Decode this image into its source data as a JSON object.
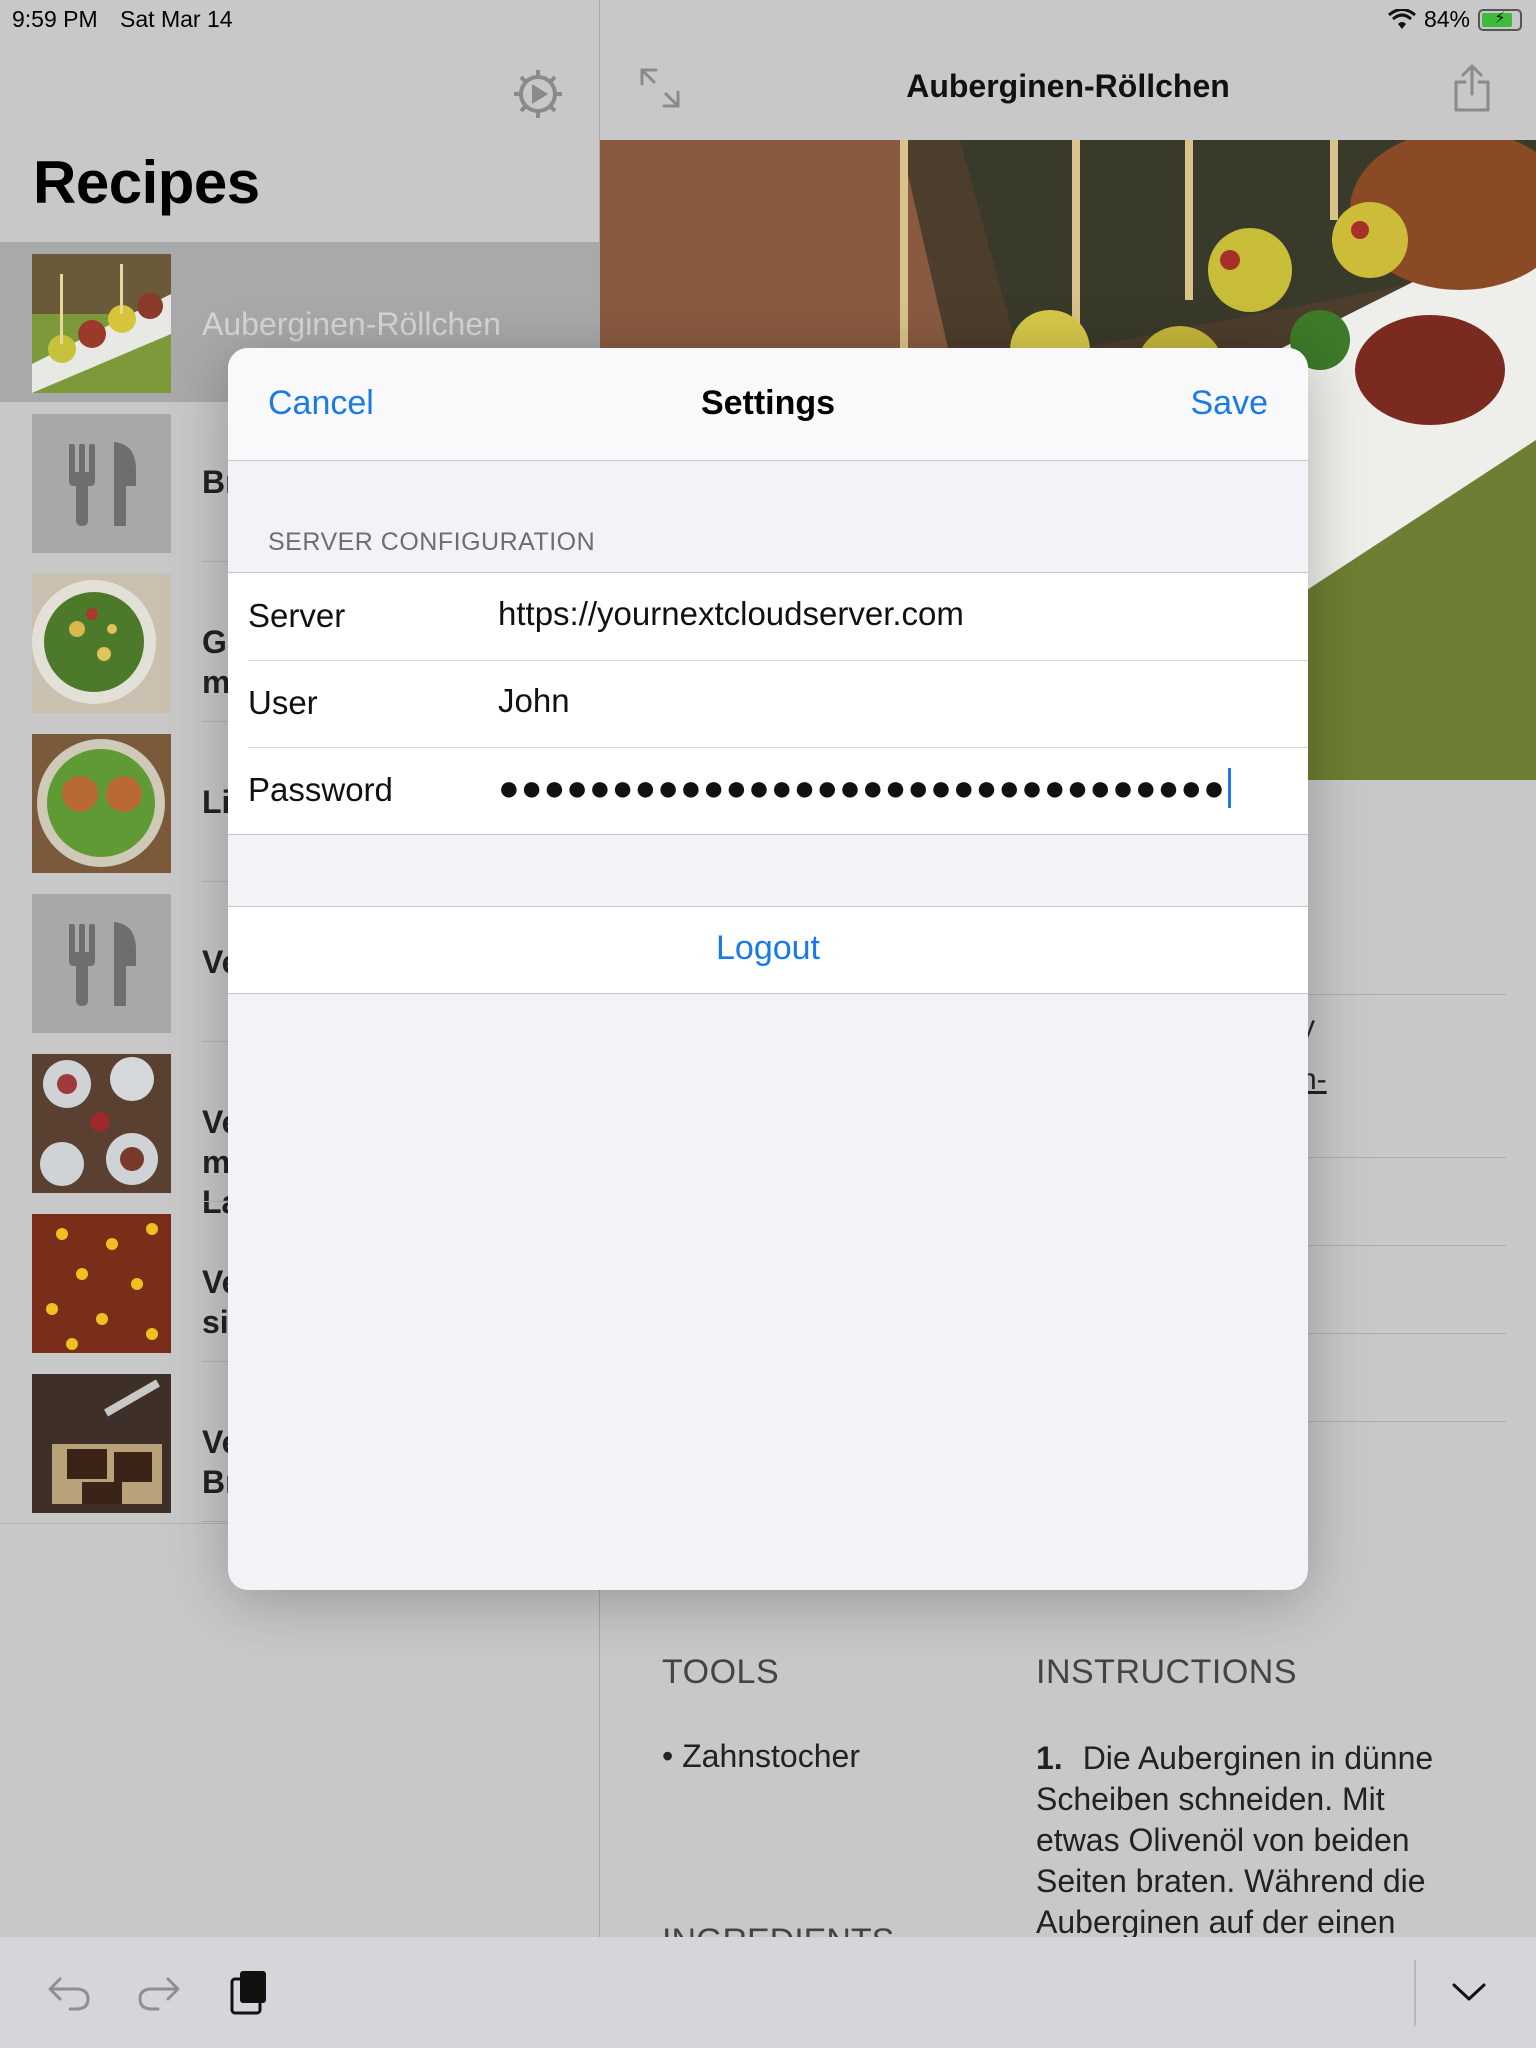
{
  "status_bar": {
    "time": "9:59 PM",
    "date": "Sat Mar 14",
    "battery": "84%",
    "battery_level": 0.84,
    "wifi_icon": "wifi-icon"
  },
  "master": {
    "title": "Recipes",
    "settings_icon": "gear-icon",
    "recipes": [
      {
        "label": "Auberginen-Röllchen",
        "thumb": "eggplant-rolls-photo",
        "selected": true
      },
      {
        "label": "Br",
        "thumb": "fork-knife-placeholder-icon"
      },
      {
        "label": "G\nm",
        "thumb": "salad-bowl-photo"
      },
      {
        "label": "Li",
        "thumb": "patty-salad-photo"
      },
      {
        "label": "Ve",
        "thumb": "fork-knife-placeholder-icon"
      },
      {
        "label": "Ve\nm\nLa",
        "thumb": "table-dishes-photo"
      },
      {
        "label": "Ve\nsi",
        "thumb": "chili-photo"
      },
      {
        "label": "Ve\nBr",
        "thumb": "brownies-photo"
      }
    ]
  },
  "detail": {
    "title": "Auberginen-Röllchen",
    "fragments": [
      "y",
      "n-"
    ],
    "tools_heading": "TOOLS",
    "tools": [
      "• Zahnstocher"
    ],
    "instructions_heading": "INSTRUCTIONS",
    "instruction_number": "1.",
    "instruction_text": "Die Auberginen in dünne Scheiben schneiden. Mit etwas Olivenöl von beiden Seiten braten. Während die Auberginen auf der einen",
    "ingredients_heading": "INGREDIENTS"
  },
  "settings_modal": {
    "title": "Settings",
    "cancel_label": "Cancel",
    "save_label": "Save",
    "section_header": "SERVER CONFIGURATION",
    "server_label": "Server",
    "server_value": "https://yournextcloudserver.com",
    "user_label": "User",
    "user_value": "John",
    "password_label": "Password",
    "password_mask": "●●●●●●●●●●●●●●●●●●●●●●●●●●●●●●●●",
    "logout_label": "Logout"
  },
  "colors": {
    "accent": "#1a7ae6",
    "battery": "#3dbb3d"
  }
}
